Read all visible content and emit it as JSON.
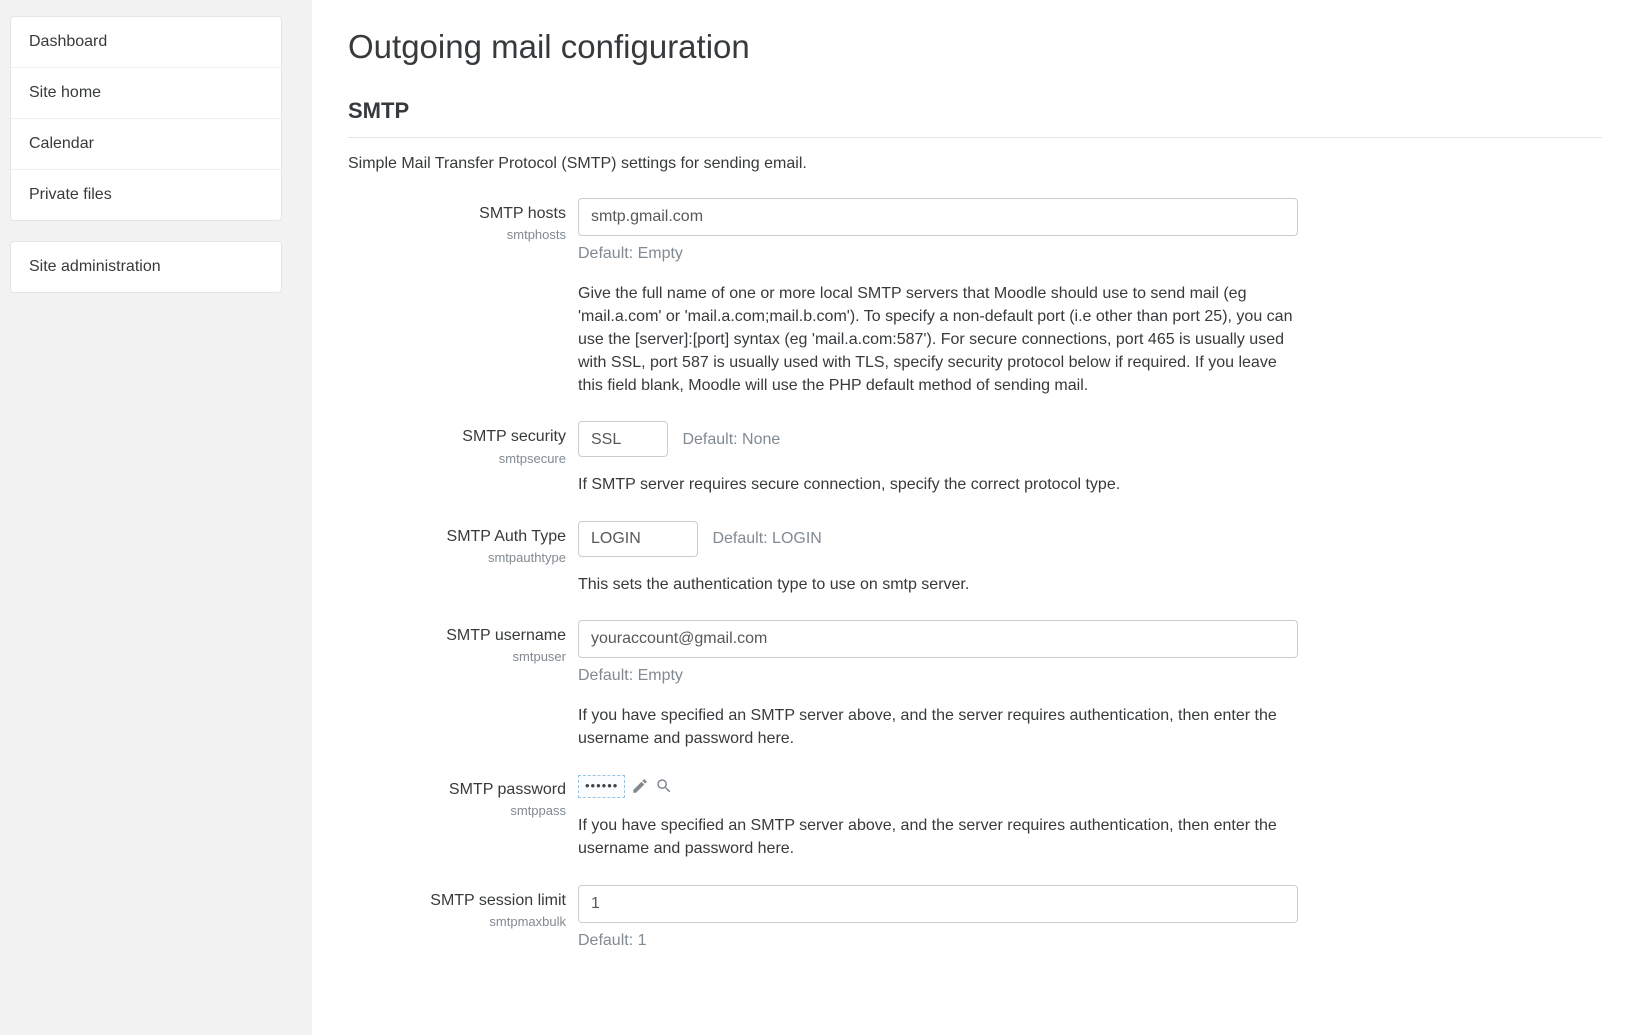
{
  "sidebar": {
    "items": [
      {
        "label": "Dashboard"
      },
      {
        "label": "Site home"
      },
      {
        "label": "Calendar"
      },
      {
        "label": "Private files"
      }
    ],
    "items2": [
      {
        "label": "Site administration"
      }
    ]
  },
  "page": {
    "title": "Outgoing mail configuration"
  },
  "section": {
    "title": "SMTP",
    "desc": "Simple Mail Transfer Protocol (SMTP) settings for sending email."
  },
  "fields": {
    "smtphosts": {
      "label": "SMTP hosts",
      "key": "smtphosts",
      "value": "smtp.gmail.com",
      "default": "Default: Empty",
      "desc": "Give the full name of one or more local SMTP servers that Moodle should use to send mail (eg 'mail.a.com' or 'mail.a.com;mail.b.com'). To specify a non-default port (i.e other than port 25), you can use the [server]:[port] syntax (eg 'mail.a.com:587'). For secure connections, port 465 is usually used with SSL, port 587 is usually used with TLS, specify security protocol below if required. If you leave this field blank, Moodle will use the PHP default method of sending mail."
    },
    "smtpsecure": {
      "label": "SMTP security",
      "key": "smtpsecure",
      "value": "SSL",
      "default": "Default: None",
      "desc": "If SMTP server requires secure connection, specify the correct protocol type."
    },
    "smtpauthtype": {
      "label": "SMTP Auth Type",
      "key": "smtpauthtype",
      "value": "LOGIN",
      "default": "Default: LOGIN",
      "desc": "This sets the authentication type to use on smtp server."
    },
    "smtpuser": {
      "label": "SMTP username",
      "key": "smtpuser",
      "value": "youraccount@gmail.com",
      "default": "Default: Empty",
      "desc": "If you have specified an SMTP server above, and the server requires authentication, then enter the username and password here."
    },
    "smtppass": {
      "label": "SMTP password",
      "key": "smtppass",
      "masked": "••••••",
      "desc": "If you have specified an SMTP server above, and the server requires authentication, then enter the username and password here."
    },
    "smtpmaxbulk": {
      "label": "SMTP session limit",
      "key": "smtpmaxbulk",
      "value": "1",
      "default": "Default: 1"
    }
  }
}
